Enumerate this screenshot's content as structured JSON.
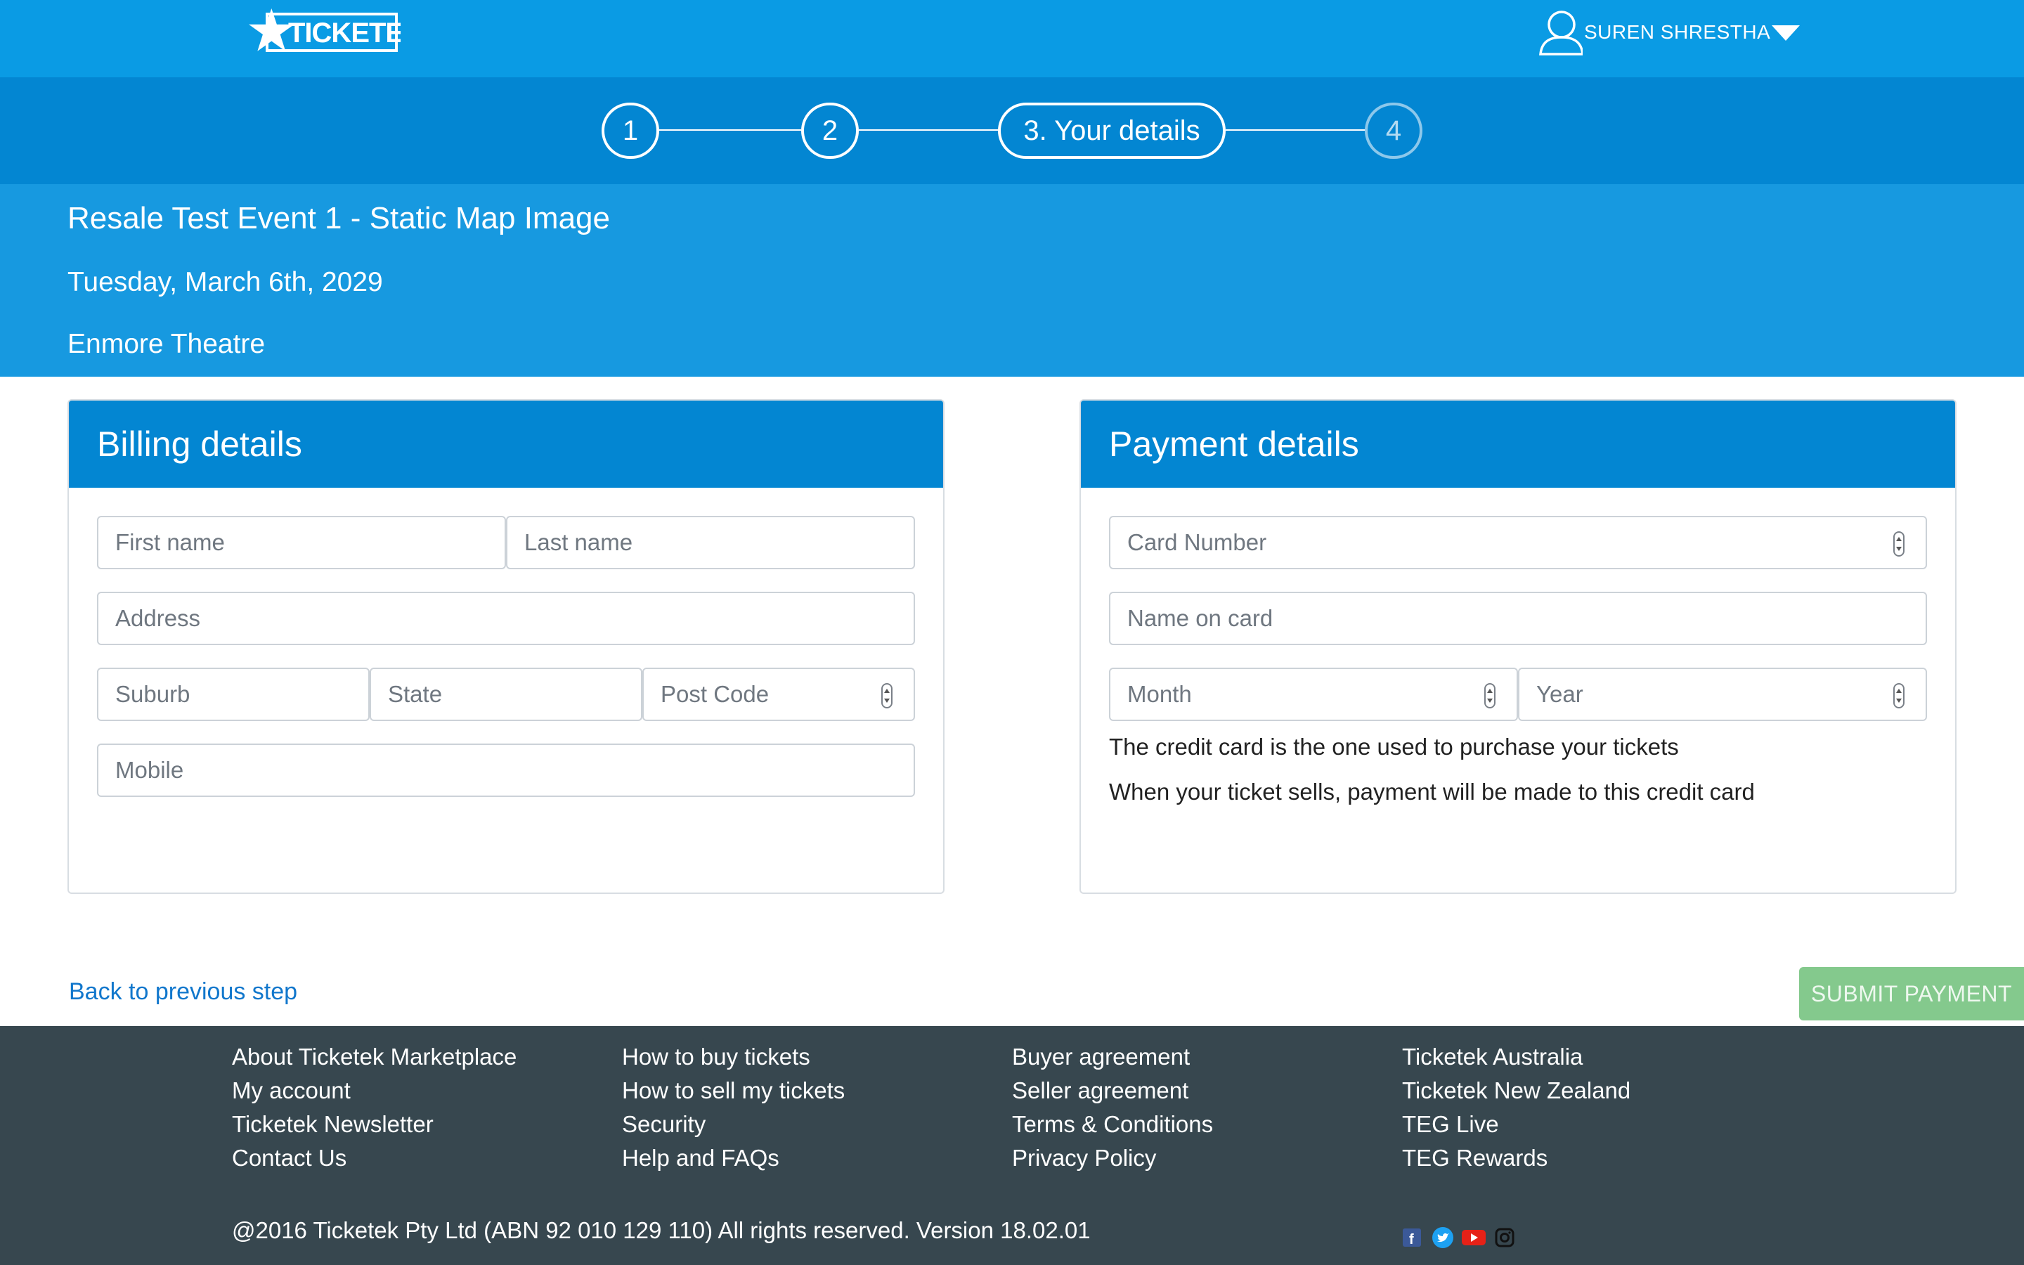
{
  "header": {
    "logo_text": "TICKETEK",
    "user_name": "SUREN SHRESTHA"
  },
  "steps": [
    {
      "label": "1"
    },
    {
      "label": "2"
    },
    {
      "label": "3. Your details"
    },
    {
      "label": "4"
    }
  ],
  "event": {
    "title": "Resale Test Event 1 - Static Map Image",
    "date": "Tuesday, March 6th, 2029",
    "venue": "Enmore Theatre"
  },
  "billing": {
    "title": "Billing details",
    "first_name_placeholder": "First name",
    "last_name_placeholder": "Last name",
    "address_placeholder": "Address",
    "suburb_placeholder": "Suburb",
    "state_placeholder": "State",
    "postcode_placeholder": "Post Code",
    "mobile_placeholder": "Mobile"
  },
  "payment": {
    "title": "Payment details",
    "card_number_placeholder": "Card Number",
    "name_on_card_placeholder": "Name on card",
    "month_placeholder": "Month",
    "year_placeholder": "Year",
    "note_1": "The credit card is the one used to purchase your tickets",
    "note_2": "When your ticket sells, payment will be made to this credit card"
  },
  "actions": {
    "back_label": "Back to previous step",
    "submit_label": "SUBMIT PAYMENT"
  },
  "footer": {
    "col1": [
      "About Ticketek Marketplace",
      "My account",
      "Ticketek Newsletter",
      "Contact Us"
    ],
    "col2": [
      "How to buy tickets",
      "How to sell my tickets",
      "Security",
      "Help and FAQs"
    ],
    "col3": [
      "Buyer agreement",
      "Seller agreement",
      "Terms & Conditions",
      "Privacy Policy"
    ],
    "col4": [
      "Ticketek Australia",
      "Ticketek New Zealand",
      "TEG Live",
      "TEG Rewards"
    ],
    "copyright": "@2016 Ticketek Pty Ltd (ABN 92 010 129 110) All rights reserved. Version 18.02.01",
    "social_icons": [
      "facebook-icon",
      "twitter-icon",
      "youtube-icon",
      "instagram-icon"
    ]
  },
  "colors": {
    "header_blue": "#0a9be4",
    "step_blue": "#0386d2",
    "band_blue": "#1799e0",
    "submit_green": "#84c98d",
    "footer_dark": "#37474f",
    "link_blue": "#1177cc"
  }
}
